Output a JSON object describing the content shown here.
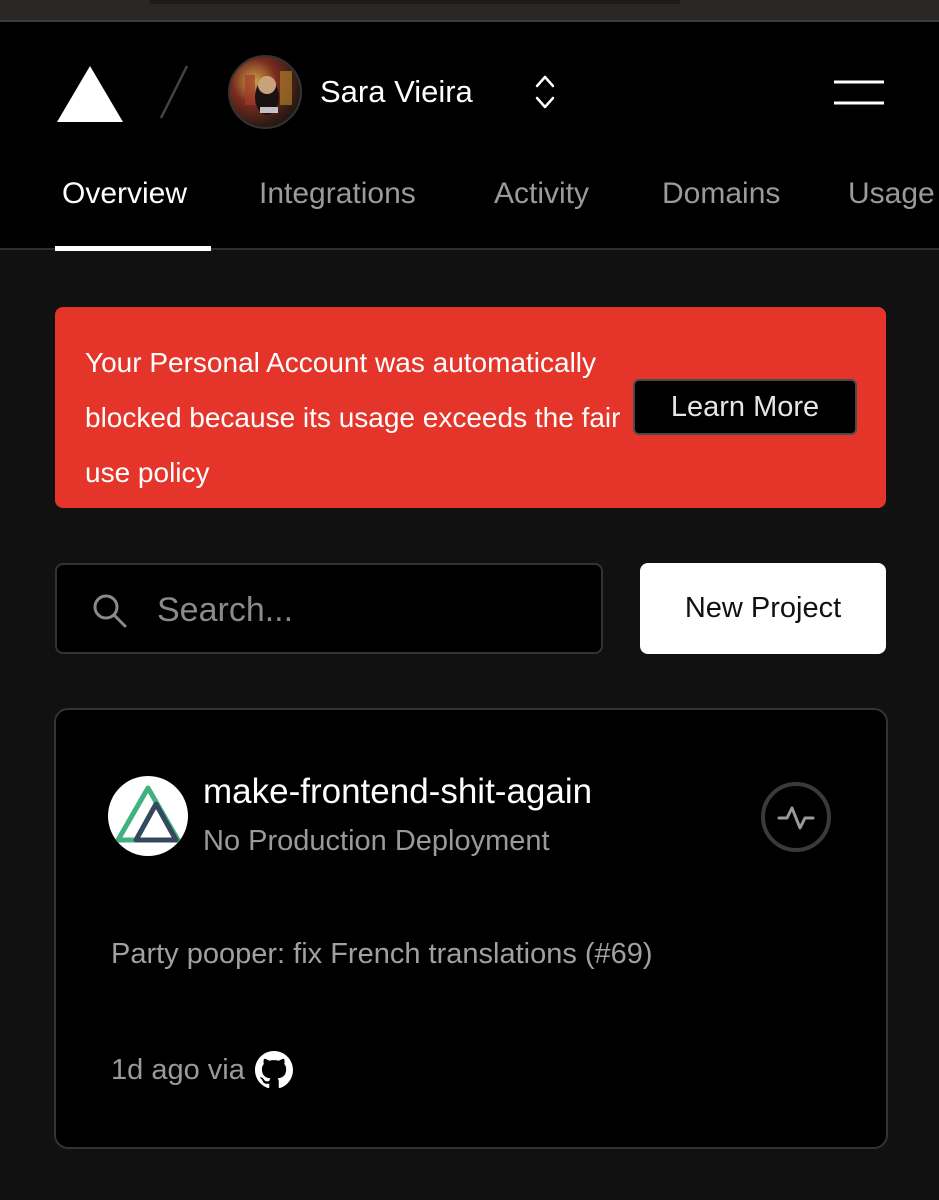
{
  "header": {
    "user_name": "Sara Vieira",
    "logo_icon": "vercel-triangle-icon",
    "switcher_icon": "chevron-up-down-icon",
    "menu_icon": "hamburger-menu-icon"
  },
  "tabs": [
    {
      "label": "Overview",
      "active": true
    },
    {
      "label": "Integrations"
    },
    {
      "label": "Activity"
    },
    {
      "label": "Domains"
    },
    {
      "label": "Usage"
    }
  ],
  "alert": {
    "message": "Your Personal Account was automatically blocked because its usage exceeds the fair use policy",
    "button_label": "Learn More",
    "color": "#e5352a"
  },
  "search": {
    "placeholder": "Search...",
    "value": "",
    "icon": "search-icon"
  },
  "new_project_label": "New Project",
  "project": {
    "name": "make-frontend-shit-again",
    "status": "No Production Deployment",
    "commit_message": "Party pooper: fix French translations (#69)",
    "meta": "1d ago via",
    "source_icon": "github-icon",
    "activity_icon": "activity-pulse-icon"
  }
}
